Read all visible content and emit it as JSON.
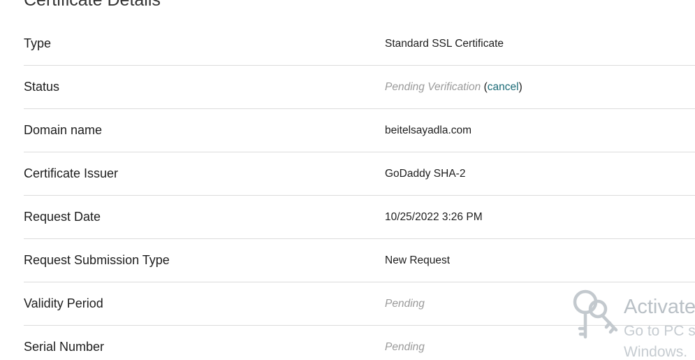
{
  "section": {
    "title": "Certificate Details"
  },
  "details": [
    {
      "label": "Type",
      "value": "Standard SSL Certificate"
    },
    {
      "label": "Status",
      "value": "Pending Verification",
      "link_open": "(",
      "link_text": "cancel",
      "link_close": ")"
    },
    {
      "label": "Domain name",
      "value": "beitelsayadla.com"
    },
    {
      "label": "Certificate Issuer",
      "value": "GoDaddy SHA-2"
    },
    {
      "label": "Request Date",
      "value": "10/25/2022 3:26 PM"
    },
    {
      "label": "Request Submission Type",
      "value": "New Request"
    },
    {
      "label": "Validity Period",
      "value": "Pending"
    },
    {
      "label": "Serial Number",
      "value": "Pending"
    }
  ],
  "watermark": {
    "icon": "key-icon",
    "title": "Activate",
    "line1": "Go to PC s",
    "line2": "Windows."
  },
  "colors": {
    "link": "#1a6a76",
    "pending_text": "#9a9a9a",
    "divider": "#dcdcdc"
  }
}
